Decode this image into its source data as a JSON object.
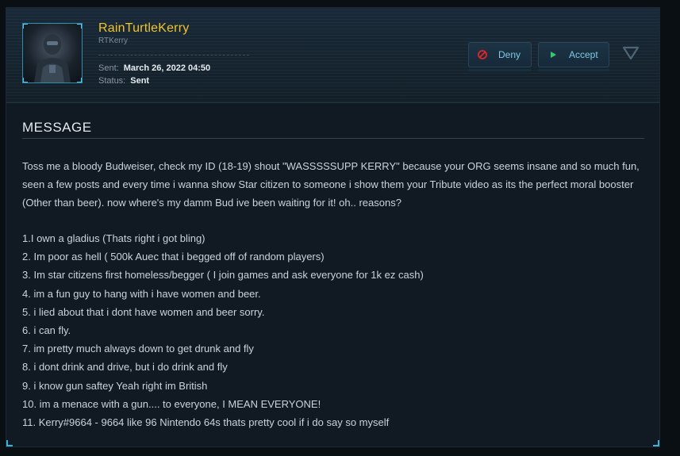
{
  "user": {
    "name": "RainTurtleKerry",
    "handle": "RTKerry"
  },
  "meta": {
    "sent_label": "Sent:",
    "sent_value": "March 26, 2022 04:50",
    "status_label": "Status:",
    "status_value": "Sent"
  },
  "actions": {
    "deny_label": "Deny",
    "accept_label": "Accept"
  },
  "colors": {
    "accent": "#2fb7d9",
    "username": "#f2c522",
    "deny_icon": "#e0262b",
    "accept_icon": "#2ecc71"
  },
  "icons": {
    "deny": "no-entry-icon",
    "accept": "play-icon",
    "collapse": "triangle-down-icon"
  },
  "message": {
    "title": "MESSAGE",
    "intro": "Toss me a bloody Budweiser, check my ID (18-19) shout \"WASSSSSUPP KERRY\" because your ORG seems insane and so much fun, seen a few posts and every time i wanna show Star citizen to someone i show them your Tribute video as its the perfect moral booster (Other than beer). now where's my damm Bud ive been waiting for it! oh.. reasons?",
    "items": [
      "1.I own a gladius (Thats right i got bling)",
      "2. Im poor as hell ( 500k Auec that i begged off of random players)",
      "3. Im star citizens first homeless/begger ( I join games and ask everyone for 1k ez cash)",
      "4. im a fun guy to hang with i have women and beer.",
      "5. i lied about that i dont have women and beer sorry.",
      "6. i can fly.",
      "7. im pretty much always down to get drunk and fly",
      "8. i dont drink and drive, but i do drink and fly",
      "9. i know gun saftey Yeah right im British",
      "10. im a menace with a gun.... to everyone, I MEAN EVERYONE!",
      "11. Kerry#9664 - 9664 like 96 Nintendo 64s thats pretty cool if i do say so myself"
    ]
  }
}
